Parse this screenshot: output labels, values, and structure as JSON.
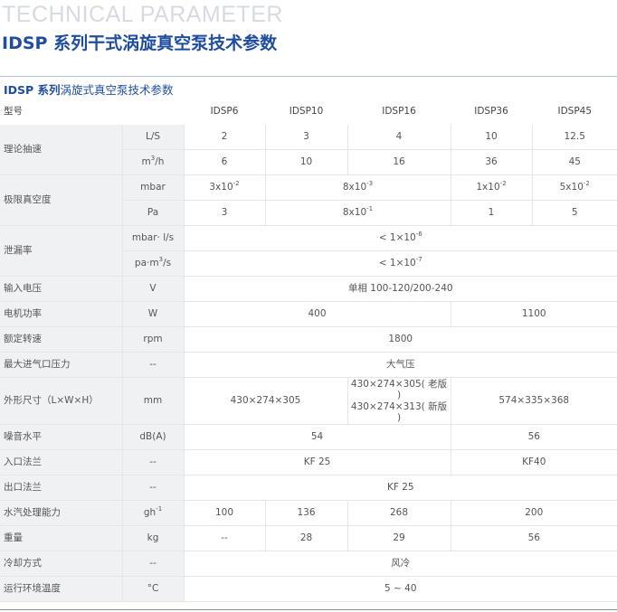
{
  "header": {
    "bg_title": "TECHNICAL PARAMETER",
    "main_title": "IDSP 系列干式涡旋真空泵技术参数",
    "table_title_bold": "IDSP 系列",
    "table_title_rest": "涡旋式真空泵技术参数"
  },
  "table": {
    "col_header": "型号",
    "models": [
      "IDSP6",
      "IDSP10",
      "IDSP16",
      "IDSP36",
      "IDSP45"
    ],
    "speed": {
      "label": "理论抽速",
      "unit_ls": "L/S",
      "vals_ls": [
        "2",
        "3",
        "4",
        "10",
        "12.5"
      ],
      "unit_m3h_pre": "m",
      "unit_m3h_sup": "3",
      "unit_m3h_post": "/h",
      "vals_m3h": [
        "6",
        "10",
        "16",
        "36",
        "45"
      ]
    },
    "ultimate": {
      "label": "极限真空度",
      "unit_mbar": "mbar",
      "mbar_1_base": "3x10",
      "mbar_1_exp": "-2",
      "mbar_2_base": "8x10",
      "mbar_2_exp": "-3",
      "mbar_3_base": "1x10",
      "mbar_3_exp": "-2",
      "mbar_4_base": "5x10",
      "mbar_4_exp": "-2",
      "unit_pa": "Pa",
      "pa_1": "3",
      "pa_2_base": "8x10",
      "pa_2_exp": "-1",
      "pa_3": "1",
      "pa_4": "5"
    },
    "leak": {
      "label": "泄漏率",
      "unit_1": "mbar· l/s",
      "val_1_base": "< 1×10",
      "val_1_exp": "-6",
      "unit_2_pre": "pa·m",
      "unit_2_sup": "3",
      "unit_2_post": "/s",
      "val_2_base": "< 1×10",
      "val_2_exp": "-7"
    },
    "voltage": {
      "label": "输入电压",
      "unit": "V",
      "value": "单相 100-120/200-240"
    },
    "power": {
      "label": "电机功率",
      "unit": "W",
      "val_a": "400",
      "val_b": "1100"
    },
    "rpm": {
      "label": "额定转速",
      "unit": "rpm",
      "value": "1800"
    },
    "inlet_pressure": {
      "label": "最大进气口压力",
      "unit": "--",
      "value": "大气压"
    },
    "dimensions": {
      "label": "外形尺寸（L×W×H）",
      "unit": "mm",
      "val_a": "430×274×305",
      "val_b1": "430×274×305( 老版 )",
      "val_b2": "430×274×313( 新版 )",
      "val_c": "574×335×368"
    },
    "noise": {
      "label": "噪音水平",
      "unit": "dB(A)",
      "val_a": "54",
      "val_b": "56"
    },
    "inlet_flange": {
      "label": "入口法兰",
      "unit": "--",
      "val_a": "KF 25",
      "val_b": "KF40"
    },
    "outlet_flange": {
      "label": "出口法兰",
      "unit": "--",
      "value": "KF 25"
    },
    "water_vapor": {
      "label": "水汽处理能力",
      "unit_base": "gh",
      "unit_sup": "-1",
      "vals": [
        "100",
        "136",
        "268",
        "200"
      ]
    },
    "weight": {
      "label": "重量",
      "unit": "kg",
      "vals": [
        "--",
        "28",
        "29",
        "56"
      ]
    },
    "cooling": {
      "label": "冷却方式",
      "unit": "--",
      "value": "风冷"
    },
    "temp": {
      "label": "运行环境温度",
      "unit": "°C",
      "value": "5 ~ 40"
    }
  }
}
